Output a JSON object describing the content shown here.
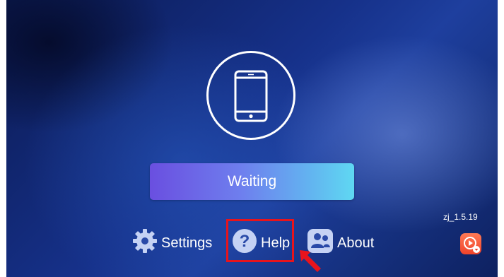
{
  "main": {
    "status_button_label": "Waiting",
    "phone_icon": "phone-icon"
  },
  "bottom_nav": {
    "items": [
      {
        "label": "Settings",
        "icon": "gear-icon"
      },
      {
        "label": "Help",
        "icon": "question-icon"
      },
      {
        "label": "About",
        "icon": "people-icon"
      }
    ]
  },
  "footer": {
    "version": "zj_1.5.19",
    "app_icon": "play-store-icon"
  },
  "annotation": {
    "highlight_color": "#e8141c",
    "target": "Help"
  },
  "colors": {
    "background": "#16318a",
    "button_gradient_start": "#6a4fe0",
    "button_gradient_end": "#5fd8f2"
  }
}
